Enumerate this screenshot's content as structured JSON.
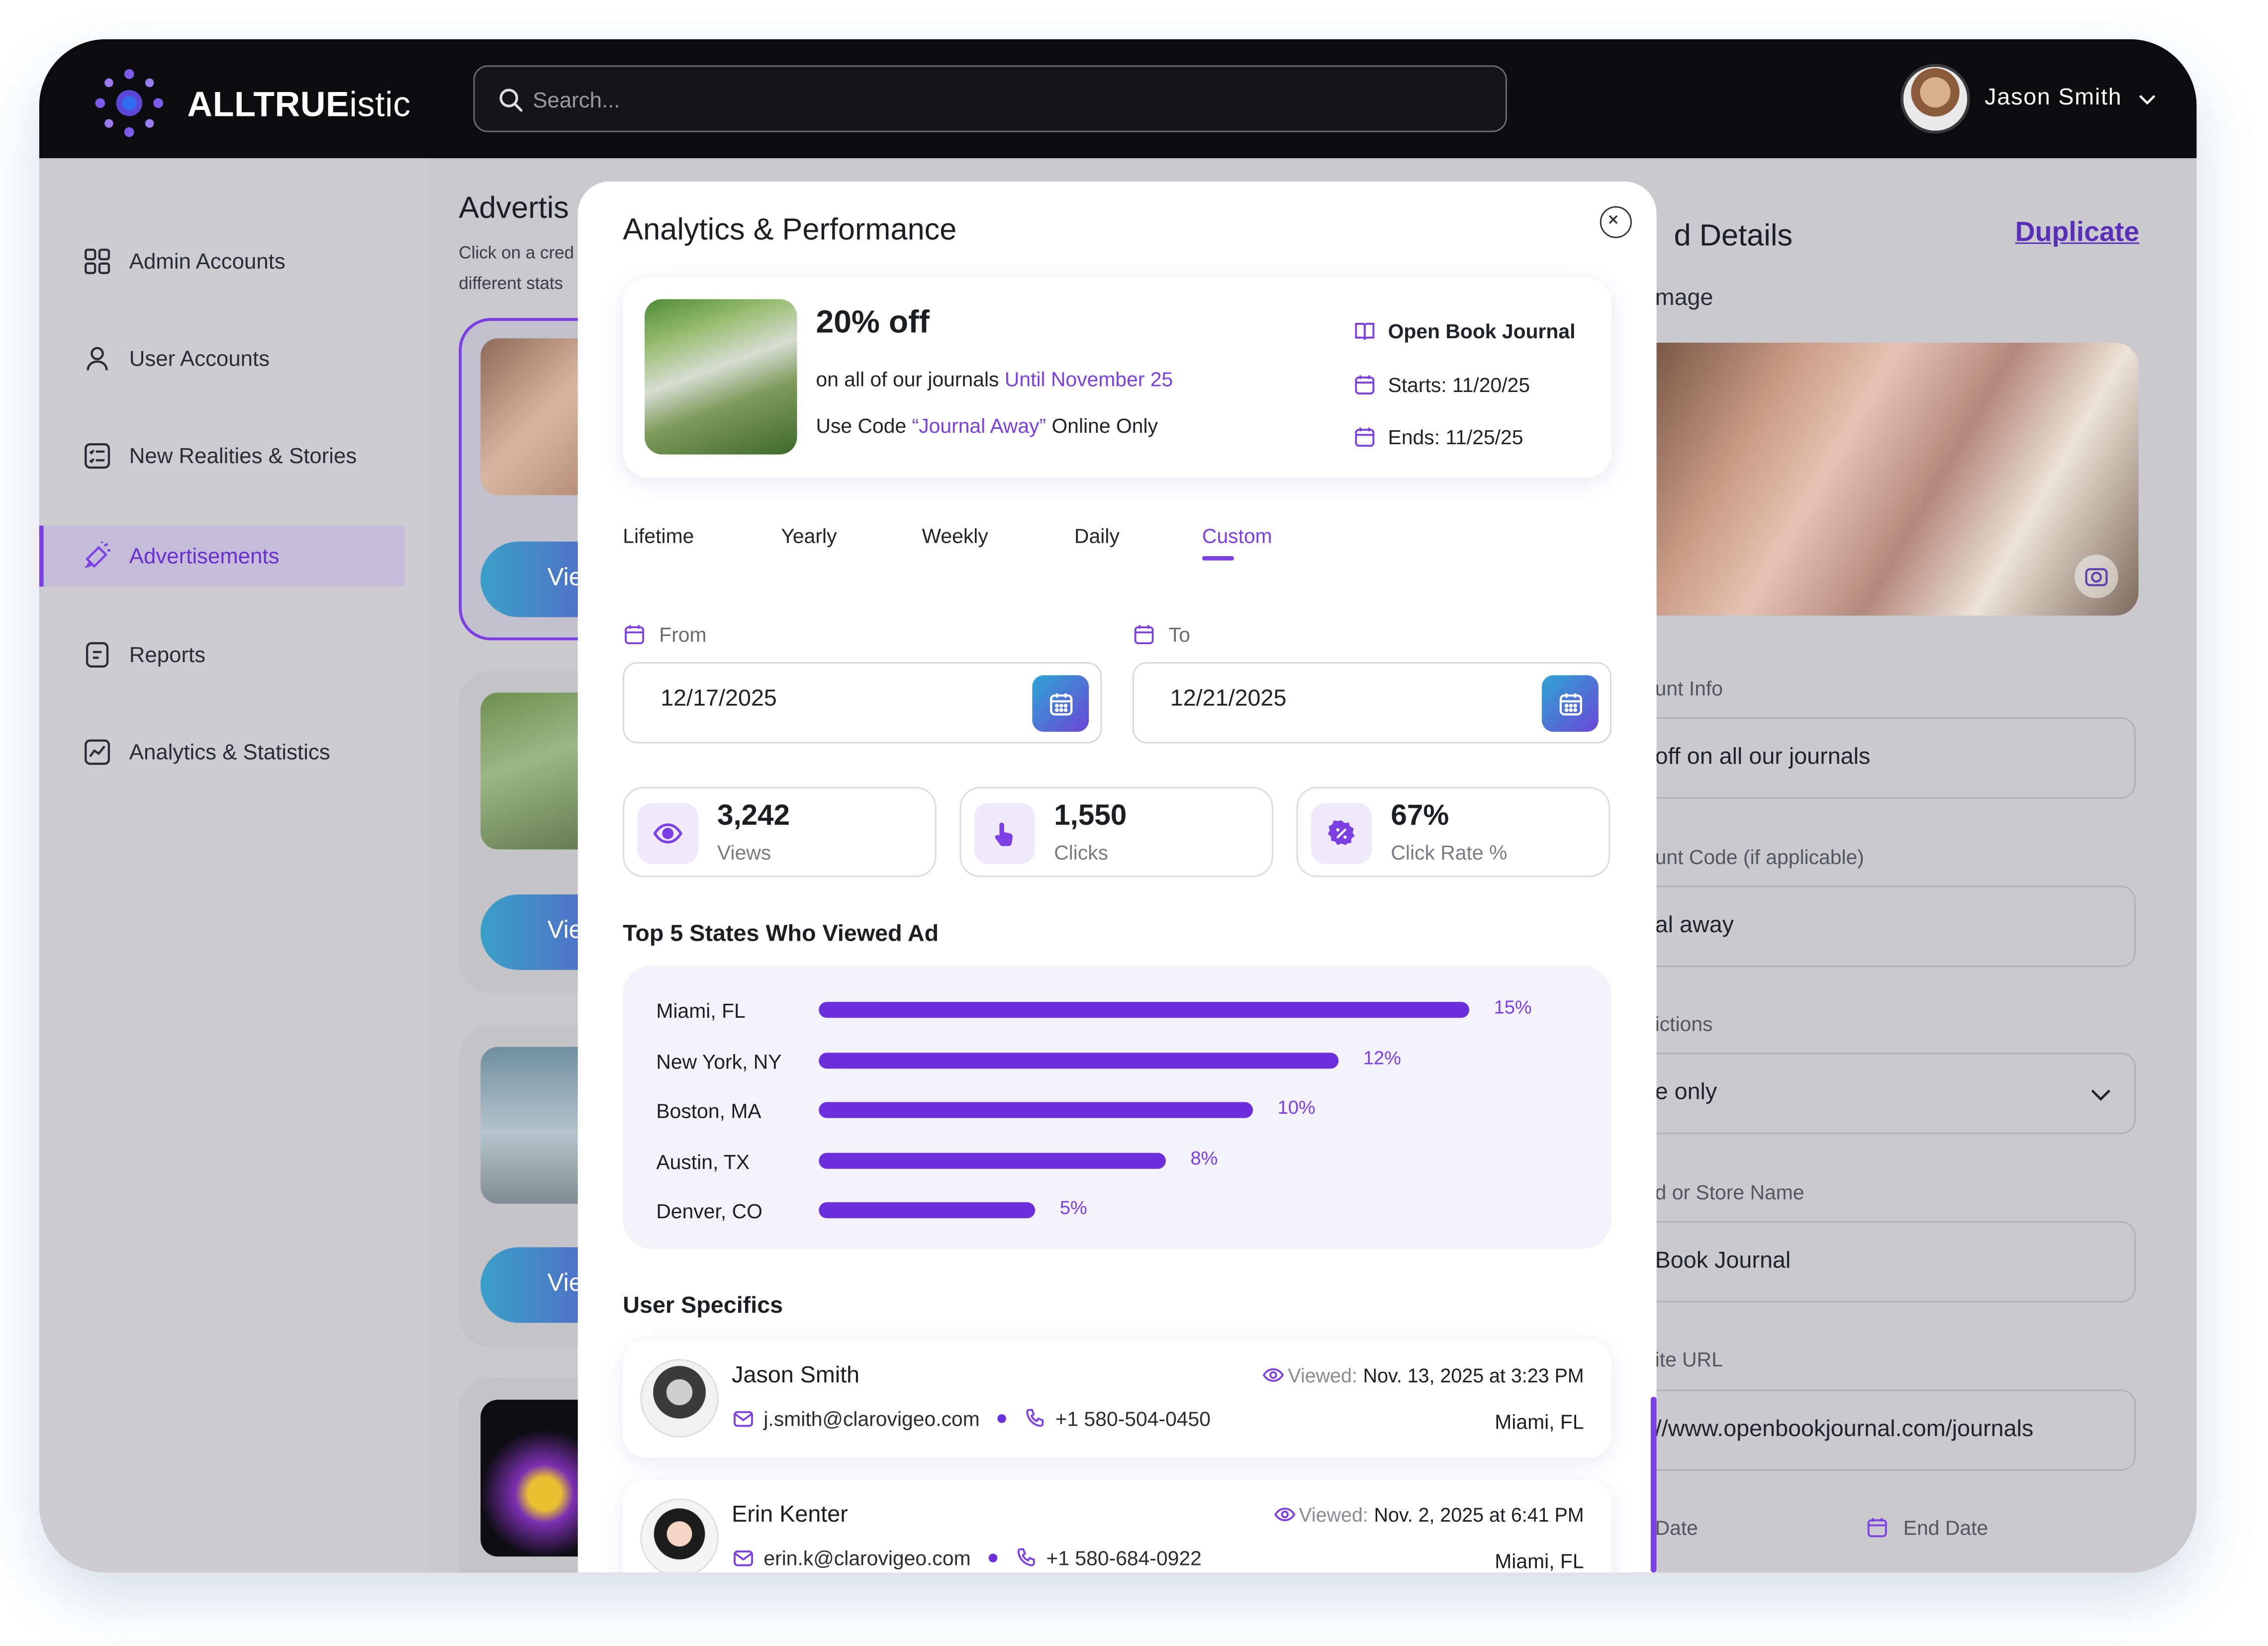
{
  "app": {
    "brand_bold": "ALLTRUE",
    "brand_rest": "istic",
    "search_placeholder": "Search...",
    "user_name": "Jason Smith"
  },
  "sidebar": {
    "items": [
      {
        "label": "Admin Accounts",
        "icon": "grid-icon"
      },
      {
        "label": "User Accounts",
        "icon": "user-icon"
      },
      {
        "label": "New Realities & Stories",
        "icon": "list-icon"
      },
      {
        "label": "Advertisements",
        "icon": "megaphone-icon",
        "active": true
      },
      {
        "label": "Reports",
        "icon": "report-icon"
      },
      {
        "label": "Analytics & Statistics",
        "icon": "chart-icon"
      }
    ]
  },
  "background": {
    "title": "Advertis",
    "subtitle": "Click on a cred different stats",
    "view_label": "Vie"
  },
  "details": {
    "title": "d Details",
    "duplicate_label": "Duplicate",
    "image_label": "mage",
    "fields": [
      {
        "label": "unt Info",
        "value": "off on all our journals"
      },
      {
        "label": "unt Code (if applicable)",
        "value": "al away"
      },
      {
        "label": "ictions",
        "value": "e only"
      },
      {
        "label": "d or Store Name",
        "value": "Book Journal"
      },
      {
        "label": "ite URL",
        "value": "//www.openbookjournal.com/journals"
      }
    ],
    "start_label": "Date",
    "end_label": "End Date"
  },
  "modal": {
    "title": "Analytics & Performance",
    "promo": {
      "headline": "20% off",
      "line1_prefix": "on all of our journals ",
      "line1_highlight": "Until November 25",
      "line2_prefix": "Use Code ",
      "line2_highlight": "“Journal Away”",
      "line2_suffix": " Online Only",
      "store": "Open Book Journal",
      "starts": "Starts: 11/20/25",
      "ends": "Ends: 11/25/25"
    },
    "tabs": [
      "Lifetime",
      "Yearly",
      "Weekly",
      "Daily",
      "Custom"
    ],
    "active_tab": "Custom",
    "from_label": "From",
    "to_label": "To",
    "from_value": "12/17/2025",
    "to_value": "12/21/2025",
    "stats": [
      {
        "value": "3,242",
        "label": "Views",
        "icon": "eye-icon"
      },
      {
        "value": "1,550",
        "label": "Clicks",
        "icon": "pointer-icon"
      },
      {
        "value": "67%",
        "label": "Click Rate %",
        "icon": "badge-percent-icon"
      }
    ],
    "top_states_title": "Top 5 States Who Viewed Ad",
    "user_specifics_title": "User Specifics",
    "users": [
      {
        "name": "Jason Smith",
        "email": "j.smith@clarovigeo.com",
        "phone": "+1 580-504-0450",
        "viewed_label": "Viewed:",
        "viewed": "Nov. 13, 2025 at 3:23 PM",
        "location": "Miami, FL"
      },
      {
        "name": "Erin Kenter",
        "email": "erin.k@clarovigeo.com",
        "phone": "+1 580-684-0922",
        "viewed_label": "Viewed:",
        "viewed": "Nov. 2, 2025 at 6:41 PM",
        "location": "Miami, FL"
      }
    ]
  },
  "chart_data": {
    "type": "bar",
    "orientation": "horizontal",
    "title": "Top 5 States Who Viewed Ad",
    "categories": [
      "Miami, FL",
      "New York, NY",
      "Boston, MA",
      "Austin, TX",
      "Denver, CO"
    ],
    "values": [
      15,
      12,
      10,
      8,
      5
    ],
    "value_labels": [
      "15%",
      "12%",
      "10%",
      "8%",
      "5%"
    ],
    "unit": "%",
    "bar_color": "#6c2fdc"
  },
  "colors": {
    "accent": "#7b3fe4",
    "topbar": "#0c0c0f"
  }
}
